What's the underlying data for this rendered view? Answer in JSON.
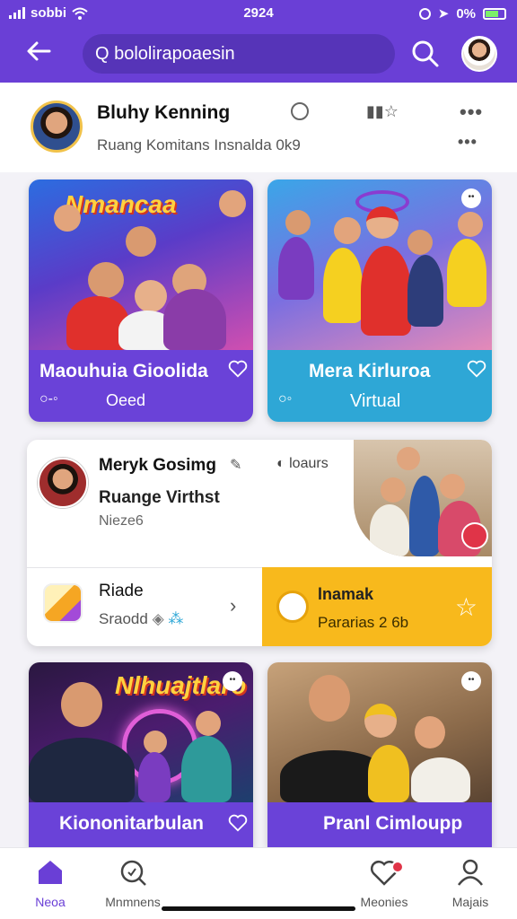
{
  "status": {
    "carrier": "sobbi",
    "time": "2924",
    "battery": "0%"
  },
  "header": {
    "search_text": "Q bololirapoaesin"
  },
  "profile": {
    "name": "Bluhy Kenning",
    "subtitle": "Ruang Komitans Insnalda 0k9"
  },
  "cards": [
    {
      "overlay": "Nmancaa",
      "title": "Maouhuia Gioolida",
      "subtitle": "Oeed",
      "band_color": "#6a42d8"
    },
    {
      "title": "Mera Kirluroa",
      "subtitle": "Virtual",
      "band_color": "#2ea7d6"
    },
    {
      "overlay": "Nlhuajtlaro",
      "title": "Kiononitarbulan",
      "band_color": "#6a42d8"
    },
    {
      "title": "Pranl Cimloupp",
      "band_color": "#6a42d8"
    }
  ],
  "wide_card": {
    "title": "Meryk Gosimg",
    "meta": "loaurs",
    "subtitle": "Ruange Virthst",
    "caption": "Nieze6",
    "app_label": "Riade",
    "app_sub": "Sraodd",
    "promo_title": "lnamak",
    "promo_sub": "Pararias 2 6b"
  },
  "nav": [
    {
      "label": "Neoa",
      "icon": "home-icon",
      "active": true
    },
    {
      "label": "Mnmnens",
      "icon": "search-icon",
      "active": false
    },
    {
      "label": "Meonies",
      "icon": "heart-icon",
      "active": false
    },
    {
      "label": "Majais",
      "icon": "user-icon",
      "active": false
    }
  ],
  "colors": {
    "brand": "#6a3fd6",
    "promo": "#f8b91c",
    "badge": "#e03448"
  }
}
